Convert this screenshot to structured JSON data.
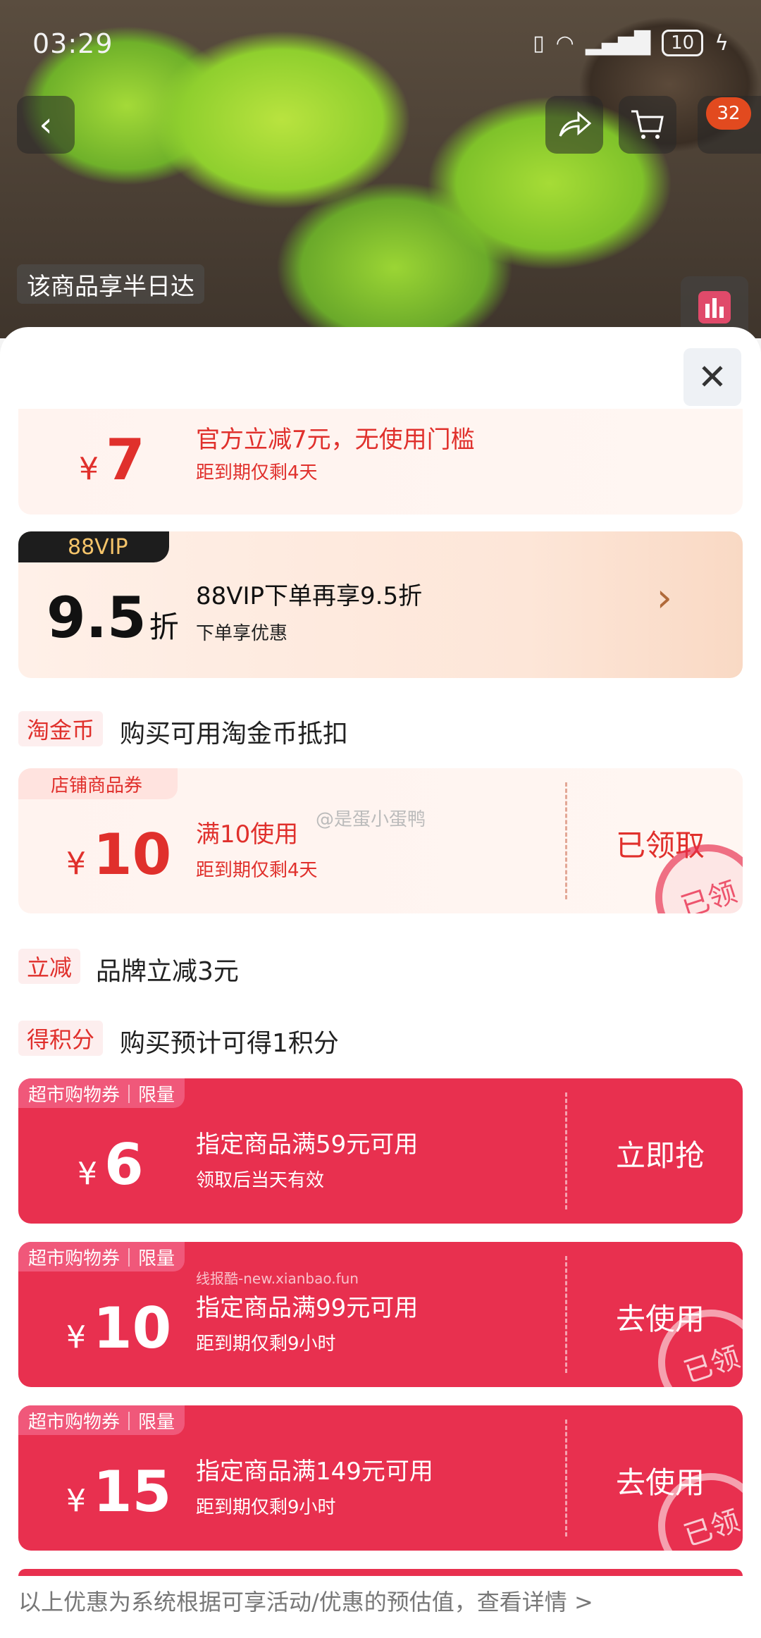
{
  "status_bar": {
    "time": "03:29",
    "battery": "10"
  },
  "header": {
    "cart_badge": "32",
    "delivery_tag": "该商品享半日达"
  },
  "coupons": {
    "official": {
      "yen": "¥",
      "amount": "7",
      "title": "官方立减7元，无使用门槛",
      "sub": "距到期仅剩4天"
    },
    "vip": {
      "tag": "88VIP",
      "amount": "9.5",
      "unit": "折",
      "title": "88VIP下单再享9.5折",
      "sub": "下单享优惠",
      "arrow": "›"
    },
    "taojinbi": {
      "label": "淘金币",
      "text": "购买可用淘金币抵扣"
    },
    "store": {
      "tag": "店铺商品券",
      "yen": "¥",
      "amount": "10",
      "title": "满10使用",
      "sub": "距到期仅剩4天",
      "action": "已领取",
      "stamp": "已领"
    },
    "brand": {
      "label": "立减",
      "text": "品牌立减3元"
    },
    "points": {
      "label": "得积分",
      "text": "购买预计可得1积分"
    },
    "market1": {
      "tag": "超市购物券｜限量",
      "yen": "¥",
      "amount": "6",
      "title": "指定商品满59元可用",
      "sub": "领取后当天有效",
      "action": "立即抢"
    },
    "market2": {
      "tag": "超市购物券｜限量",
      "yen": "¥",
      "amount": "10",
      "title": "指定商品满99元可用",
      "sub": "距到期仅剩9小时",
      "action": "去使用",
      "stamp": "已领"
    },
    "market3": {
      "tag": "超市购物券｜限量",
      "yen": "¥",
      "amount": "15",
      "title": "指定商品满149元可用",
      "sub": "距到期仅剩9小时",
      "action": "去使用",
      "stamp": "已领"
    }
  },
  "watermarks": {
    "weibo": "@是蛋小蛋鸭",
    "site": "线报酷-new.xianbao.fun"
  },
  "footer": {
    "note": "以上优惠为系统根据可享活动/优惠的预估值，查看详情 >"
  },
  "colors": {
    "accent_red": "#e8304f",
    "price_red": "#e0302c"
  }
}
